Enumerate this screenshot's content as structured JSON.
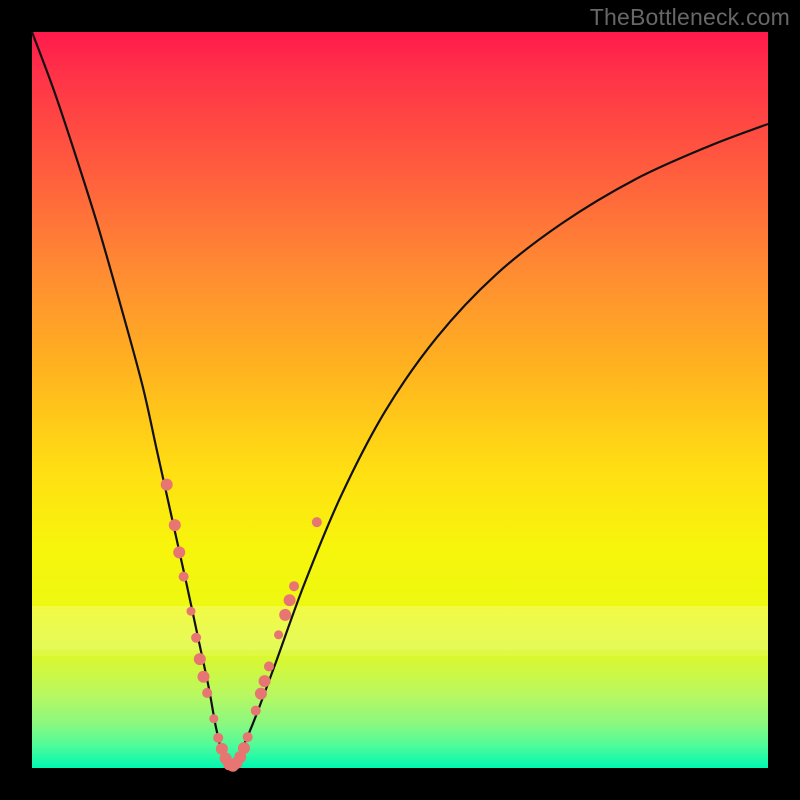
{
  "watermark": "TheBottleneck.com",
  "colors": {
    "background": "#000000",
    "marker": "#e77572",
    "curve": "#111111"
  },
  "chart_data": {
    "type": "line",
    "title": "",
    "xlabel": "",
    "ylabel": "",
    "xlim": [
      0,
      100
    ],
    "ylim": [
      0,
      100
    ],
    "background_gradient": [
      "#ff1a4c",
      "#ffe012",
      "#00f8b0"
    ],
    "series": [
      {
        "name": "bottleneck-curve",
        "x": [
          0,
          3,
          6,
          9,
          12,
          15,
          17,
          19,
          21,
          22.5,
          24,
          25,
          26,
          27,
          28,
          30,
          33,
          37,
          42,
          48,
          55,
          63,
          72,
          82,
          92,
          100
        ],
        "y": [
          100,
          92,
          83,
          73.5,
          63,
          52,
          43,
          34,
          25,
          18,
          11,
          5.5,
          1.5,
          0,
          1.5,
          6,
          14,
          25,
          37,
          48.5,
          58.5,
          67,
          74,
          80,
          84.5,
          87.5
        ]
      }
    ],
    "markers": {
      "name": "highlighted-points",
      "points": [
        {
          "x": 18.3,
          "y": 38.5,
          "r": 6
        },
        {
          "x": 19.4,
          "y": 33,
          "r": 6
        },
        {
          "x": 20.0,
          "y": 29.3,
          "r": 6
        },
        {
          "x": 20.6,
          "y": 26.0,
          "r": 5
        },
        {
          "x": 21.6,
          "y": 21.3,
          "r": 4.5
        },
        {
          "x": 22.3,
          "y": 17.7,
          "r": 5
        },
        {
          "x": 22.8,
          "y": 14.8,
          "r": 6
        },
        {
          "x": 23.3,
          "y": 12.4,
          "r": 6
        },
        {
          "x": 23.8,
          "y": 10.2,
          "r": 5
        },
        {
          "x": 24.7,
          "y": 6.7,
          "r": 4.5
        },
        {
          "x": 25.3,
          "y": 4.1,
          "r": 5
        },
        {
          "x": 25.8,
          "y": 2.6,
          "r": 6
        },
        {
          "x": 26.3,
          "y": 1.3,
          "r": 6
        },
        {
          "x": 26.8,
          "y": 0.5,
          "r": 6
        },
        {
          "x": 27.3,
          "y": 0.3,
          "r": 6
        },
        {
          "x": 27.8,
          "y": 0.7,
          "r": 6
        },
        {
          "x": 28.3,
          "y": 1.5,
          "r": 6
        },
        {
          "x": 28.8,
          "y": 2.7,
          "r": 6
        },
        {
          "x": 29.3,
          "y": 4.2,
          "r": 5
        },
        {
          "x": 30.4,
          "y": 7.8,
          "r": 5
        },
        {
          "x": 31.1,
          "y": 10.1,
          "r": 6
        },
        {
          "x": 31.6,
          "y": 11.8,
          "r": 6
        },
        {
          "x": 32.2,
          "y": 13.8,
          "r": 5
        },
        {
          "x": 33.5,
          "y": 18.1,
          "r": 4.5
        },
        {
          "x": 34.4,
          "y": 20.8,
          "r": 6
        },
        {
          "x": 35.0,
          "y": 22.8,
          "r": 6
        },
        {
          "x": 35.6,
          "y": 24.7,
          "r": 5
        },
        {
          "x": 38.7,
          "y": 33.4,
          "r": 5
        }
      ]
    }
  }
}
